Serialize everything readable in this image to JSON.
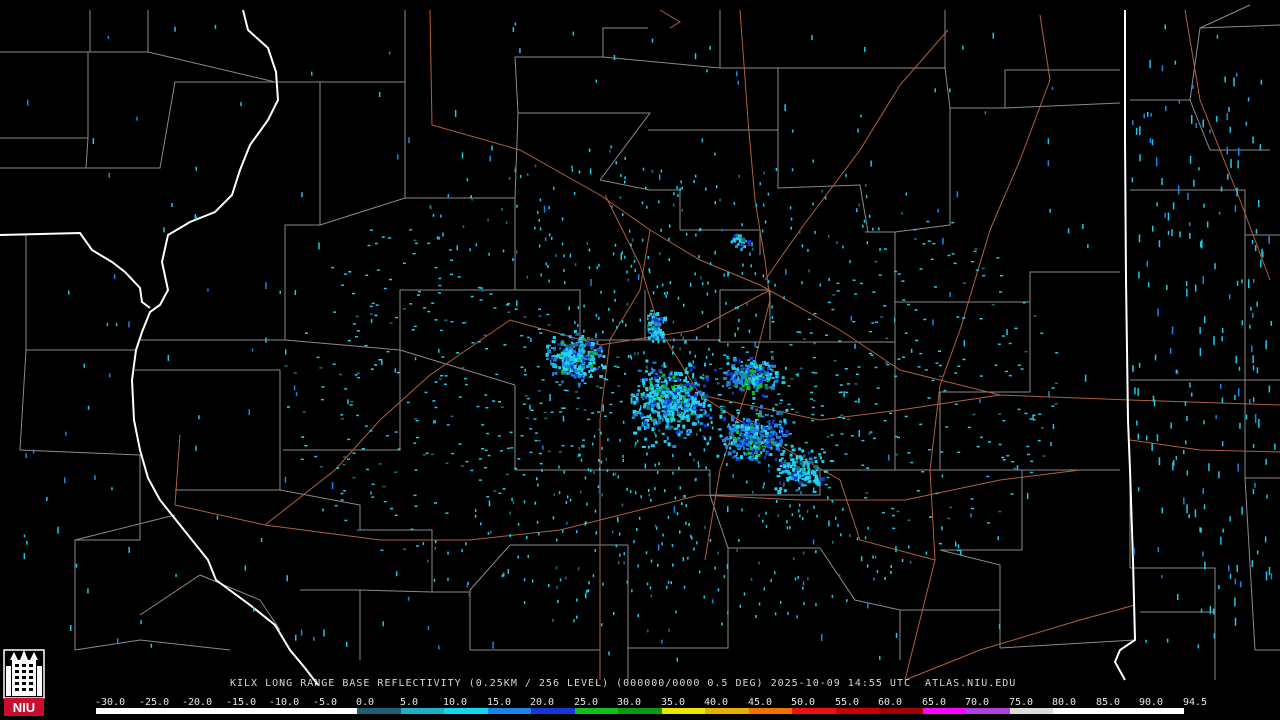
{
  "caption": {
    "product": "KILX LONG RANGE BASE REFLECTIVITY (0.25KM / 256 LEVEL) (000000/0000 0.5 DEG) 2025-10-09 14:55 UTC",
    "site": "ATLAS.NIU.EDU"
  },
  "legend": {
    "labels": [
      "-30.0",
      "-25.0",
      "-20.0",
      "-15.0",
      "-10.0",
      "-5.0",
      "0.0",
      "5.0",
      "10.0",
      "15.0",
      "20.0",
      "25.0",
      "30.0",
      "35.0",
      "40.0",
      "45.0",
      "50.0",
      "55.0",
      "60.0",
      "65.0",
      "70.0",
      "75.0",
      "80.0",
      "85.0",
      "90.0",
      "94.5"
    ],
    "colors": [
      "#000000",
      "#000000",
      "#000000",
      "#000000",
      "#000000",
      "#000000",
      "#1f5f6f",
      "#1fb0c8",
      "#12d6f0",
      "#1c84e6",
      "#1238d8",
      "#10c020",
      "#0a9a10",
      "#e8e800",
      "#e8b000",
      "#f07000",
      "#f01010",
      "#c80000",
      "#a00000",
      "#ff00ff",
      "#b040e0",
      "#dcdcdc",
      "#ffffff",
      "#ffffff",
      "#ffffff"
    ]
  },
  "map": {
    "colors": {
      "background": "#000000",
      "state_border": "#ffffff",
      "county_border": "#8a8a8a",
      "highway": "#b0613a"
    }
  },
  "radar": {
    "site_id": "KILX",
    "echo_colors": [
      "#1f6f7f",
      "#1ec8e6",
      "#22d8f6",
      "#1c84e6",
      "#1238d8",
      "#10c020"
    ]
  },
  "logo": {
    "text": "NIU",
    "colors": {
      "background": "#c8102e",
      "emblem": "#ffffff"
    }
  }
}
